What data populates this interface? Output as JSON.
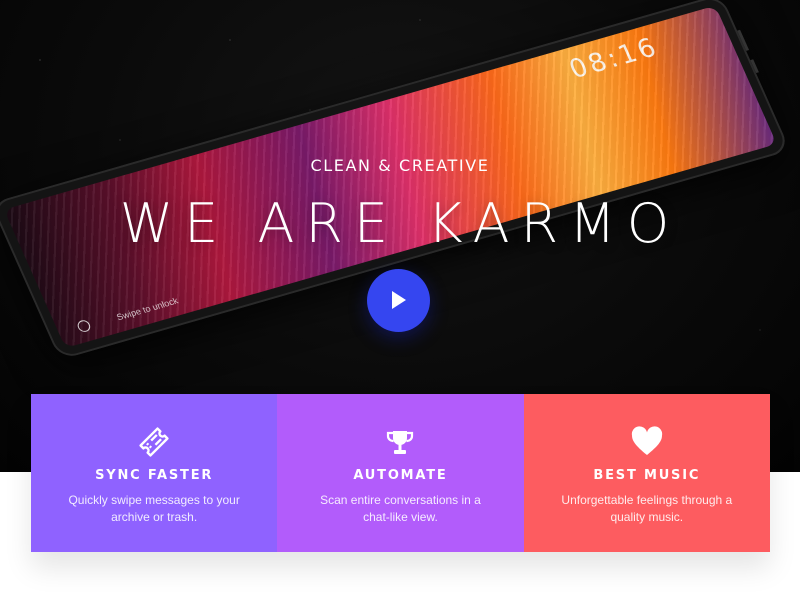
{
  "hero": {
    "subtitle": "CLEAN & CREATIVE",
    "title": "WE ARE KARMO",
    "play_button_color": "#3546f0",
    "phone": {
      "clock": "08:16",
      "swipe_hint": "Swipe to unlock"
    }
  },
  "features": [
    {
      "icon": "ticket-icon",
      "title": "SYNC FASTER",
      "text": "Quickly swipe messages to your archive or trash.",
      "color": "#8f62ff"
    },
    {
      "icon": "trophy-icon",
      "title": "AUTOMATE",
      "text": "Scan entire conversations in a chat-like view.",
      "color": "#b25cfb"
    },
    {
      "icon": "heart-icon",
      "title": "BEST MUSIC",
      "text": "Unforgettable feelings through a quality music.",
      "color": "#fd5c60"
    }
  ]
}
